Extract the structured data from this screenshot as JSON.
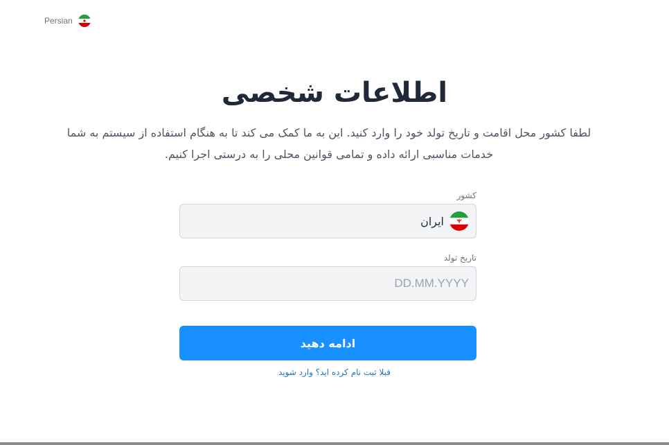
{
  "language": {
    "label": "Persian",
    "flag_icon": "iran-flag-icon"
  },
  "header": {
    "title": "اطلاعات شخصی",
    "subtitle": "لطفا کشور محل اقامت و تاریخ تولد خود را وارد کنید. این به ما کمک می کند تا به هنگام استفاده از سیستم به شما خدمات مناسبی ارائه داده و تمامی قوانین محلی را به درستی اجرا کنیم."
  },
  "form": {
    "country": {
      "label": "کشور",
      "value": "ایران",
      "flag_icon": "iran-flag-icon"
    },
    "birthdate": {
      "label": "تاریخ تولد",
      "placeholder": "DD.MM.YYYY",
      "value": ""
    },
    "submit_label": "ادامه دهید",
    "login_link": "قبلا ثبت نام کرده اید؟ وارد شوید"
  },
  "colors": {
    "primary": "#1890ff",
    "link": "#1a73c4",
    "input_bg": "#f3f4f6",
    "title": "#1f2937"
  }
}
